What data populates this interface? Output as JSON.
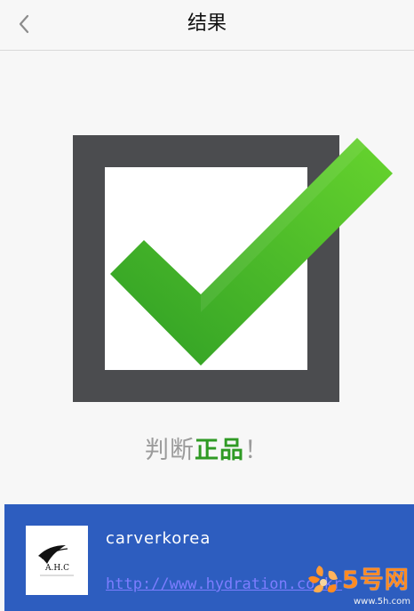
{
  "header": {
    "back_icon": "chevron-left-icon",
    "title": "结果"
  },
  "result": {
    "status": "verified",
    "text_prefix": "判断",
    "text_verdict": "正品",
    "text_suffix": "！"
  },
  "brand_card": {
    "logo_text": "A.H.C",
    "brand_name": "carverkorea",
    "link_text": "http://www.hydration.co.kr"
  },
  "watermark": {
    "main_text": "5号网",
    "url_text": "www.5h.com"
  },
  "colors": {
    "accent": "#2d5dbf",
    "success": "#2f9a24",
    "frame": "#4b4c4f",
    "link": "#7d7dff",
    "watermark": "#ff8a21"
  }
}
